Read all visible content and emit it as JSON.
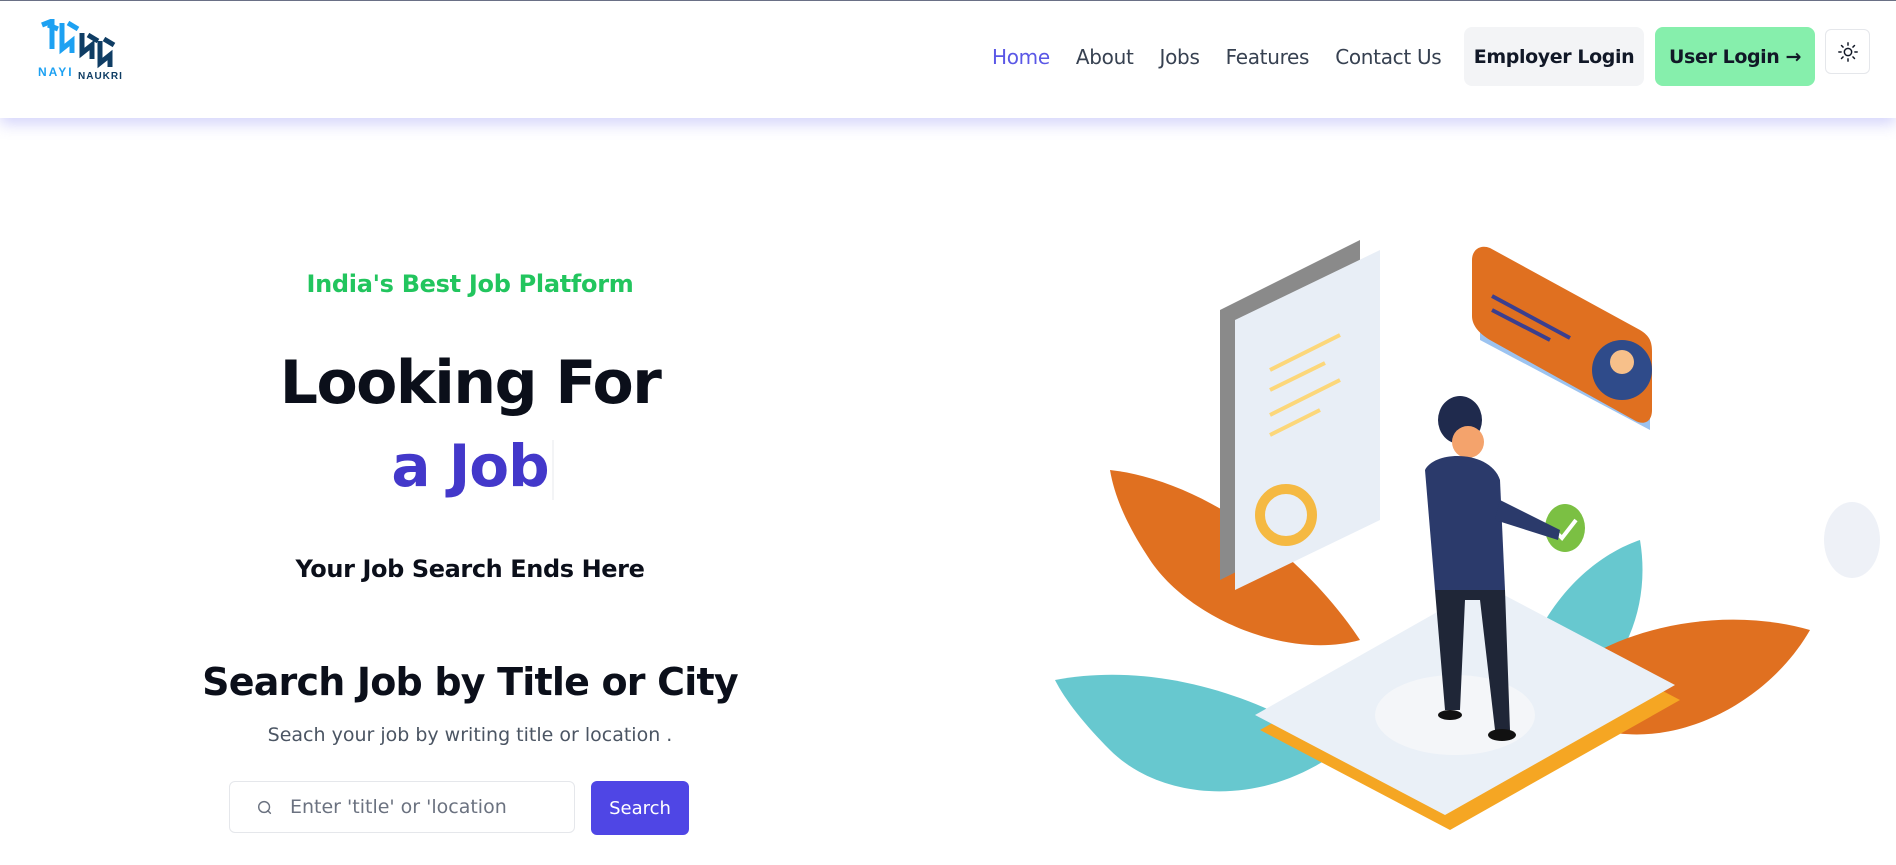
{
  "brand": {
    "logo_word_1": "NAYI",
    "logo_word_2": "NAUKRI"
  },
  "nav": {
    "links": [
      "Home",
      "About",
      "Jobs",
      "Features",
      "Contact Us"
    ],
    "active_index": 0,
    "employer_login": "Employer Login",
    "user_login": "User Login",
    "user_login_arrow": "→"
  },
  "hero": {
    "tagline": "India's Best Job Platform",
    "headline": "Looking For",
    "headline_accent": "a Job",
    "subhead": "Your Job Search Ends Here"
  },
  "search": {
    "title": "Search Job by Title or City",
    "subtitle": "Seach your job by writing title or location .",
    "placeholder": "Enter 'title' or 'location",
    "button": "Search"
  },
  "colors": {
    "accent": "#4f46e5",
    "tagline_green": "#22c55e",
    "user_login_bg": "#86efac",
    "nav_active": "#5a57e6"
  },
  "icons": {
    "theme_toggle": "sun-icon",
    "search_field": "search-icon",
    "user_login": "arrow-right-icon"
  }
}
